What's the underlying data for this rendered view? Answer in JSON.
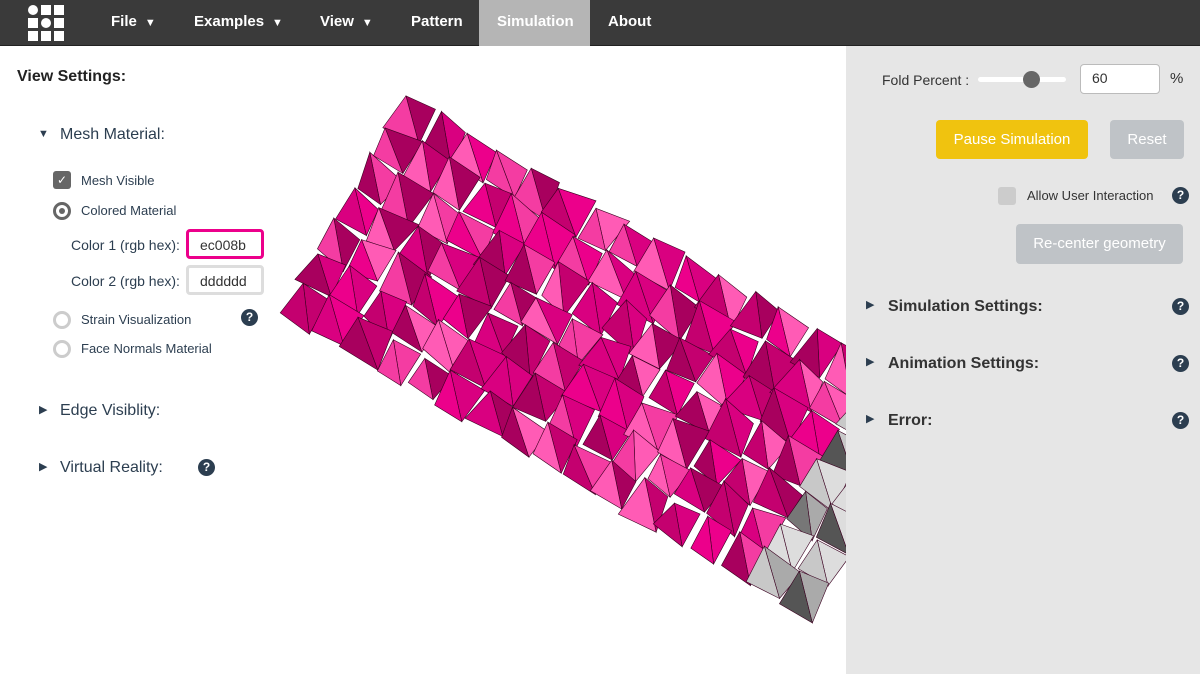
{
  "nav": {
    "items": [
      {
        "label": "File",
        "caret": true
      },
      {
        "label": "Examples",
        "caret": true
      },
      {
        "label": "View",
        "caret": true
      },
      {
        "label": "Pattern"
      },
      {
        "label": "Simulation",
        "active": true
      },
      {
        "label": "About"
      }
    ]
  },
  "left": {
    "title": "View Settings:",
    "mesh_material": "Mesh Material:",
    "mesh_visible": "Mesh Visible",
    "colored_material": "Colored Material",
    "color1_label": "Color 1 (rgb hex):",
    "color1_value": "ec008b",
    "color2_label": "Color 2 (rgb hex):",
    "color2_value": "dddddd",
    "strain": "Strain Visualization",
    "normals": "Face Normals Material",
    "edge": "Edge Visiblity:",
    "vr": "Virtual Reality:",
    "help": "?"
  },
  "right": {
    "fold_label": "Fold Percent :",
    "fold_value": "60",
    "fold_percent": 60,
    "percent_sign": "%",
    "pause": "Pause Simulation",
    "reset": "Reset",
    "allow": "Allow User Interaction",
    "recenter": "Re-center geometry",
    "sim_settings": "Simulation Settings:",
    "anim_settings": "Animation Settings:",
    "error": "Error:"
  },
  "colors": {
    "accent": "#f0c30f",
    "mesh": "#ec008b",
    "mesh2": "#dddddd",
    "nav": "#3a3a3a",
    "panel": "#e6e6e6"
  }
}
